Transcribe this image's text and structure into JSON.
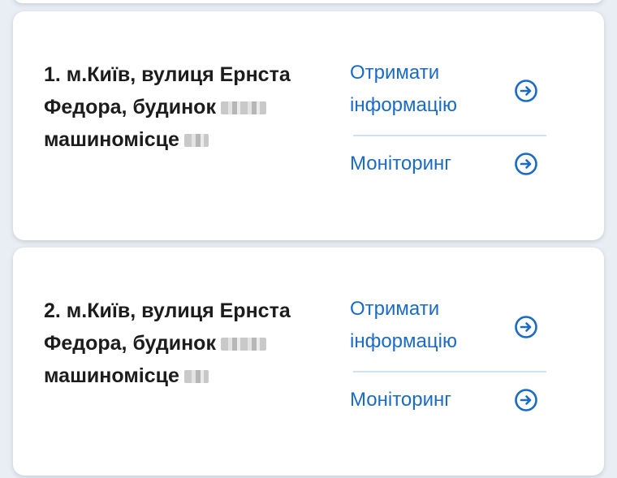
{
  "colors": {
    "accent": "#1b6bc4",
    "divider": "#cfe1f5",
    "text": "#1c1c1c",
    "background": "#e9eef4",
    "card": "#ffffff"
  },
  "cards": [
    {
      "address_line1": "1. м.Київ, вулиця Ернста",
      "address_line2": "Федора, будинок",
      "address_line3": "машиномісце",
      "get_info_line1": "Отримати",
      "get_info_line2": "інформацію",
      "monitoring": "Моніторинг",
      "icon": "arrow-right-circle-icon"
    },
    {
      "address_line1": "2. м.Київ, вулиця Ернста",
      "address_line2": "Федора, будинок",
      "address_line3": "машиномісце",
      "get_info_line1": "Отримати",
      "get_info_line2": "інформацію",
      "monitoring": "Моніторинг",
      "icon": "arrow-right-circle-icon"
    }
  ]
}
